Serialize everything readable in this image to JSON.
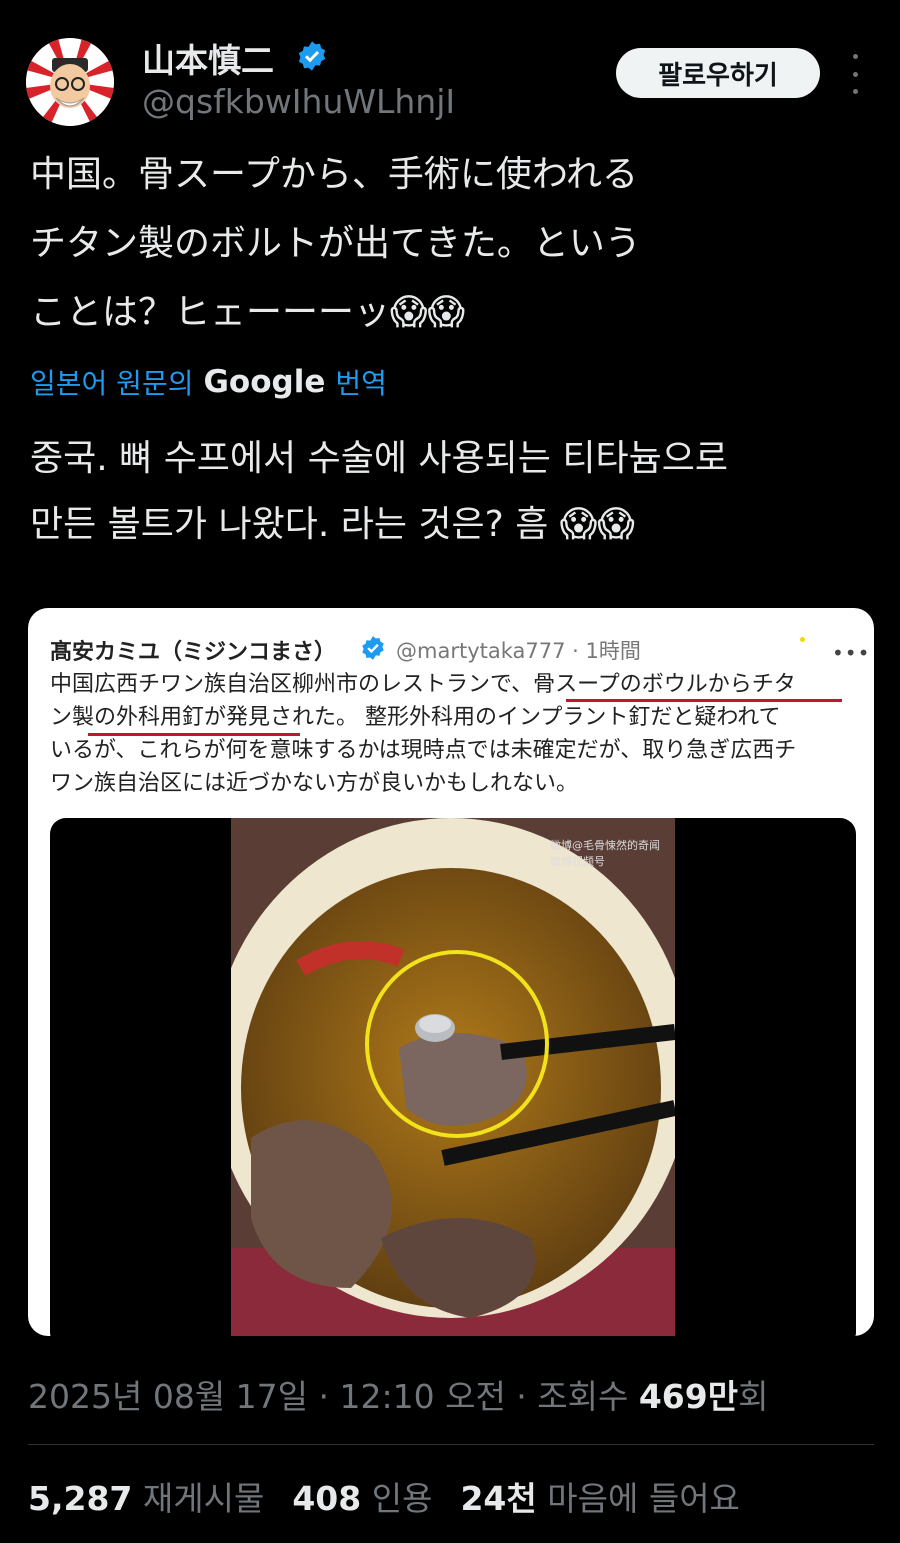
{
  "author": {
    "display_name": "山本慎二",
    "handle": "@qsfkbwIhuWLhnjI",
    "avatar_icon": "cartoon-avatar-icon",
    "verified_icon": "verified-badge-icon"
  },
  "header": {
    "follow_label": "팔로우하기",
    "more_icon": "more-vertical-icon"
  },
  "post": {
    "text": "中国。骨スープから、手術に使われる\nチタン製のボルトが出てきた。という\nことは？ヒェーーーッ😱😱",
    "translate_prefix": "일본어 원문의",
    "translate_brand": "Google",
    "translate_suffix": "번역",
    "translated_text": "중국. 뼈 수프에서 수술에 사용되는 티타늄으로\n만든 볼트가 나왔다. 라는 것은? 흠 😱😱"
  },
  "quoted": {
    "name": "髙安カミユ（ミジンコまさ）",
    "handle_time": "@martytaka777 · 1時間",
    "text": "中国広西チワン族自治区柳州市のレストランで、骨スープのボウルからチタ\nン製の外科用釘が発見された。 整形外科用のインプラント釘だと疑われて\nいるが、これらが何を意味するかは現時点では未確定だが、取り急ぎ広西チ\nワン族自治区には近づかない方が良いかもしれない。",
    "more": "•••",
    "watermark_line1": "微博@毛骨悚然的奇闻",
    "watermark_line2": "微博视频号"
  },
  "meta": {
    "datetime": "2025년 08월 17일 · 12:10 오전 · 조회수 ",
    "views": "469만",
    "views_suffix": "회"
  },
  "stats": {
    "reposts_value": "5,287",
    "reposts_label": "재게시물",
    "quotes_value": "408",
    "quotes_label": "인용",
    "likes_value": "24천",
    "likes_label": "마음에 들어요"
  },
  "colors": {
    "background": "#000000",
    "link": "#1d9bf0",
    "muted": "#71767b",
    "circle_highlight": "#f2e21a",
    "underline": "#c0182a"
  }
}
